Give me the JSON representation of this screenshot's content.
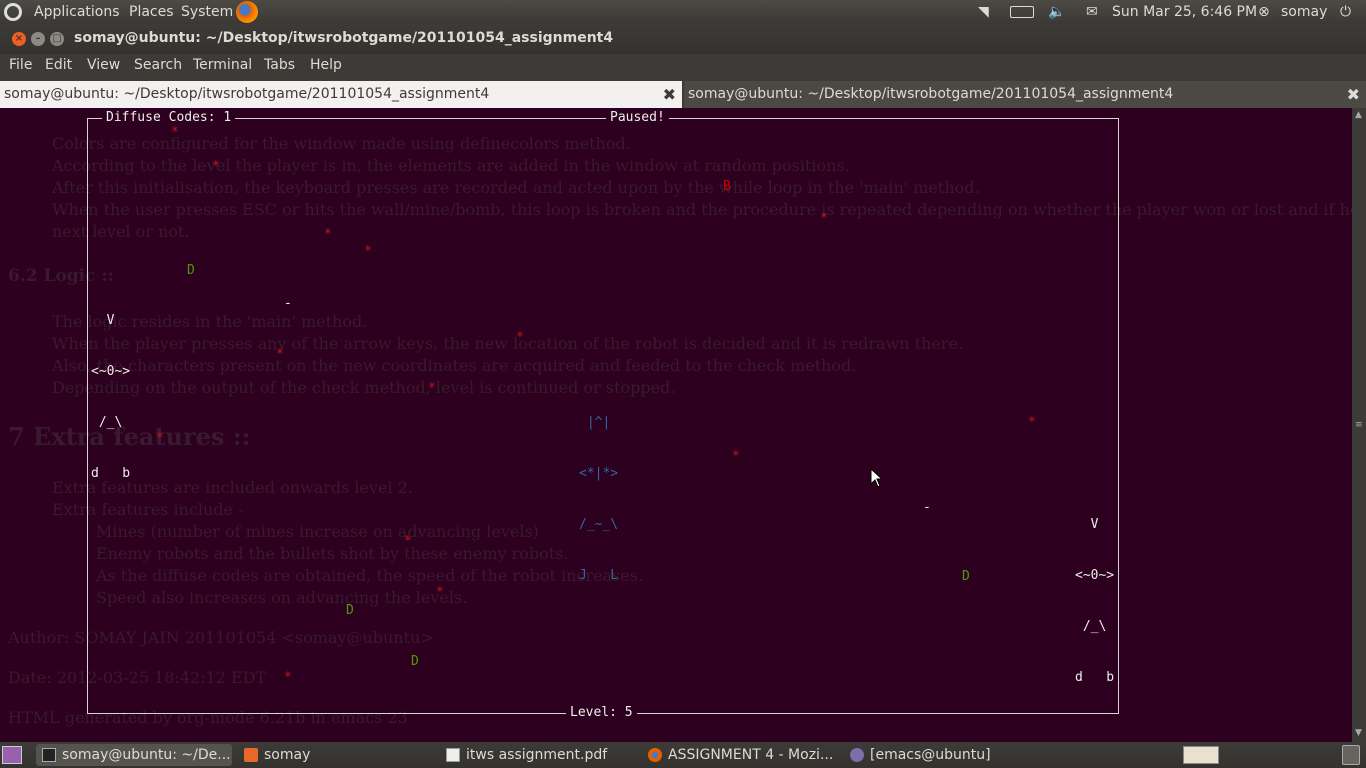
{
  "top_panel": {
    "menus": [
      "Applications",
      "Places",
      "System"
    ],
    "clock": "Sun Mar 25,  6:46 PM",
    "user": "somay",
    "icons": [
      "ubuntu-icon",
      "firefox-icon",
      "wifi-icon",
      "battery-icon",
      "volume-icon",
      "mail-icon",
      "user-status-icon",
      "power-icon"
    ]
  },
  "window": {
    "title": "somay@ubuntu: ~/Desktop/itwsrobotgame/201101054_assignment4",
    "menu": [
      "File",
      "Edit",
      "View",
      "Search",
      "Terminal",
      "Tabs",
      "Help"
    ],
    "tabs": [
      {
        "label": "somay@ubuntu: ~/Desktop/itwsrobotgame/201101054_assignment4",
        "active": true
      },
      {
        "label": "somay@ubuntu: ~/Desktop/itwsrobotgame/201101054_assignment4",
        "active": false
      }
    ]
  },
  "game": {
    "diffuse_label": "Diffuse Codes: 1",
    "paused": "Paused!",
    "level_label": "Level: 5",
    "robot_lines": [
      "  V",
      "<~0~>",
      " /_\\",
      "d   b"
    ],
    "enemy_lines": [
      " |^|",
      "<*|*>",
      "/_~_\\",
      "J   L"
    ],
    "mine": "*",
    "diffuse_code": "D",
    "bomb": "B",
    "bullet": "-"
  },
  "ghost_text": {
    "lines": [
      "Colors are configured for the window made using definecolors method.",
      "According to the level the player is in, the elements are added in the window at random positions.",
      "After this initialisation, the keyboard presses are recorded and acted upon by the while loop in the 'main' method.",
      "When the user presses ESC or hits the wall/mine/bomb, this loop is broken and the procedure is repeated depending on whether the player won or lost and if he wants to play the",
      "next level or not.",
      "6.2 Logic ::",
      "The logic resides in the 'main' method.",
      "When the player presses any of the arrow keys, the new location of the robot is decided and it is redrawn there.",
      "Also, the characters present on the new coordinates are acquired and feeded to the check method.",
      "Depending on the output of the check method, level is continued or stopped.",
      "7 Extra features ::",
      "Extra features are included onwards level 2.",
      "Extra features include -",
      "Mines (number of mines increase on advancing levels)",
      "Enemy robots and the bullets shot by these enemy robots.",
      "As the diffuse codes are obtained, the speed of the robot increases.",
      "Speed also increases on advancing the levels.",
      "Author: SOMAY JAIN 201101054 <somay@ubuntu>",
      "Date: 2012-03-25 18:42:12 EDT",
      "HTML generated by org-mode 6.21b in emacs 23"
    ]
  },
  "taskbar": {
    "items": [
      {
        "label": "somay@ubuntu: ~/De...",
        "icon": "terminal-icon"
      },
      {
        "label": "somay",
        "icon": "home-folder-icon"
      },
      {
        "label": "itws assignment.pdf",
        "icon": "pdf-icon"
      },
      {
        "label": "ASSIGNMENT 4 - Mozi...",
        "icon": "firefox-icon"
      },
      {
        "label": "[emacs@ubuntu]",
        "icon": "emacs-icon"
      }
    ]
  }
}
